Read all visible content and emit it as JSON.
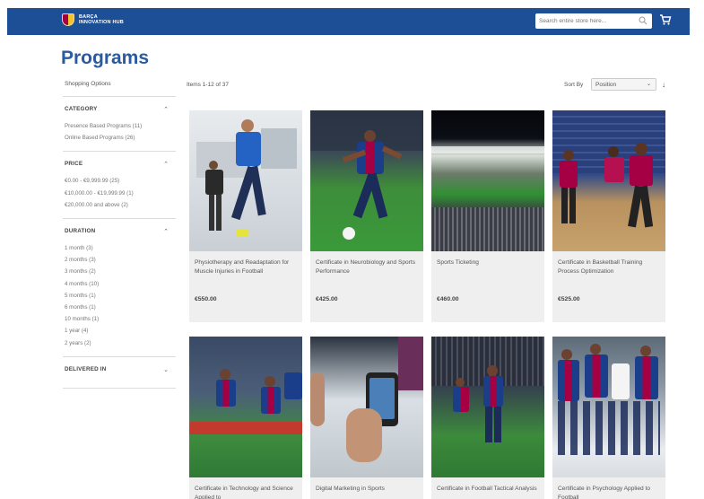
{
  "header": {
    "logo_line1": "BARÇA",
    "logo_line2": "INNOVATION HUB",
    "search_placeholder": "Search entire store here..."
  },
  "page": {
    "title": "Programs"
  },
  "sidebar": {
    "shopping_options": "Shopping Options",
    "filters": [
      {
        "title": "CATEGORY",
        "items": [
          "Presence Based Programs (11)",
          "Online Based Programs (26)"
        ]
      },
      {
        "title": "PRICE",
        "items": [
          "€0.00 - €9,999.99 (25)",
          "€10,000.00 - €19,999.99 (1)",
          "€20,000.00 and above (2)"
        ]
      },
      {
        "title": "DURATION",
        "items": [
          "1 month (3)",
          "2 months (3)",
          "3 months (2)",
          "4 months (10)",
          "5 months (1)",
          "6 months (1)",
          "10 months (1)",
          "1 year (4)",
          "2 years (2)"
        ]
      },
      {
        "title": "DELIVERED IN",
        "items": []
      }
    ]
  },
  "toolbar": {
    "count": "Items 1-12 of 37",
    "sort_label": "Sort By",
    "sort_value": "Position",
    "sort_direction": "↓"
  },
  "products": [
    {
      "name": "Physiotherapy and Readaptation for Muscle Injuries in Football",
      "price": "€550.00"
    },
    {
      "name": "Certificate in Neurobiology and Sports Performance",
      "price": "€425.00"
    },
    {
      "name": "Sports Ticketing",
      "price": "€460.00"
    },
    {
      "name": "Certificate in Basketball Training Process Optimization",
      "price": "€525.00"
    },
    {
      "name": "Certificate in Technology and Science Applied to",
      "price": ""
    },
    {
      "name": "Digital Marketing in Sports",
      "price": ""
    },
    {
      "name": "Certificate in Football Tactical Analysis",
      "price": ""
    },
    {
      "name": "Certificate in Psychology Applied to Football",
      "price": ""
    }
  ],
  "colors": {
    "brand_blue": "#1c4f95",
    "title_blue": "#2a5aa0",
    "card_bg": "#efefef"
  }
}
